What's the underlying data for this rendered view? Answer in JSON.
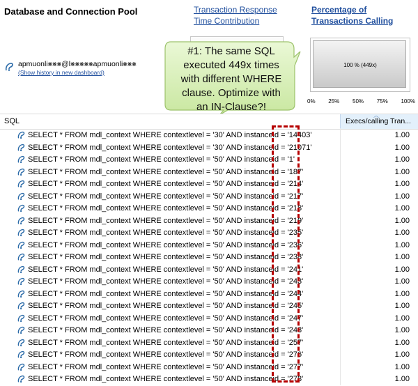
{
  "header": {
    "title": "Database and Connection Pool",
    "tab_response_line1": "Transaction Response",
    "tab_response_line2": "Time Contribution",
    "tab_pct_line1": "Percentage of",
    "tab_pct_line2": "Transactions Calling"
  },
  "connection": {
    "name": "apmuonli⨳⨳⨳@l⨳⨳⨳⨳⨳apmuonli⨳⨳⨳",
    "history_link": "(Show history in new dashboard)"
  },
  "percent_chart": {
    "label": "100 % (449x)",
    "value_percent": 100,
    "ticks": [
      "0%",
      "25%",
      "50%",
      "75%",
      "100%"
    ]
  },
  "callout": {
    "text_lines": [
      "#1: The same SQL",
      "executed 449x times",
      "with different WHERE",
      "clause. Optimize with",
      "an IN-Clause?!"
    ],
    "fill": "#d6f0b4",
    "stroke": "#9cc26b"
  },
  "table": {
    "col_sql": "SQL",
    "col_execs": "Execs/calling Tran...",
    "rows": [
      {
        "sql": "SELECT * FROM mdl_context WHERE contextlevel = '30' AND instanceid = '14403'",
        "value": "1.00"
      },
      {
        "sql": "SELECT * FROM mdl_context WHERE contextlevel = '30' AND instanceid = '21071'",
        "value": "1.00"
      },
      {
        "sql": "SELECT * FROM mdl_context WHERE contextlevel = '50' AND instanceid = '1'",
        "value": "1.00"
      },
      {
        "sql": "SELECT * FROM mdl_context WHERE contextlevel = '50' AND instanceid = '187'",
        "value": "1.00"
      },
      {
        "sql": "SELECT * FROM mdl_context WHERE contextlevel = '50' AND instanceid = '214'",
        "value": "1.00"
      },
      {
        "sql": "SELECT * FROM mdl_context WHERE contextlevel = '50' AND instanceid = '217'",
        "value": "1.00"
      },
      {
        "sql": "SELECT * FROM mdl_context WHERE contextlevel = '50' AND instanceid = '218'",
        "value": "1.00"
      },
      {
        "sql": "SELECT * FROM mdl_context WHERE contextlevel = '50' AND instanceid = '219'",
        "value": "1.00"
      },
      {
        "sql": "SELECT * FROM mdl_context WHERE contextlevel = '50' AND instanceid = '235'",
        "value": "1.00"
      },
      {
        "sql": "SELECT * FROM mdl_context WHERE contextlevel = '50' AND instanceid = '236'",
        "value": "1.00"
      },
      {
        "sql": "SELECT * FROM mdl_context WHERE contextlevel = '50' AND instanceid = '238'",
        "value": "1.00"
      },
      {
        "sql": "SELECT * FROM mdl_context WHERE contextlevel = '50' AND instanceid = '241'",
        "value": "1.00"
      },
      {
        "sql": "SELECT * FROM mdl_context WHERE contextlevel = '50' AND instanceid = '243'",
        "value": "1.00"
      },
      {
        "sql": "SELECT * FROM mdl_context WHERE contextlevel = '50' AND instanceid = '244'",
        "value": "1.00"
      },
      {
        "sql": "SELECT * FROM mdl_context WHERE contextlevel = '50' AND instanceid = '245'",
        "value": "1.00"
      },
      {
        "sql": "SELECT * FROM mdl_context WHERE contextlevel = '50' AND instanceid = '247'",
        "value": "1.00"
      },
      {
        "sql": "SELECT * FROM mdl_context WHERE contextlevel = '50' AND instanceid = '248'",
        "value": "1.00"
      },
      {
        "sql": "SELECT * FROM mdl_context WHERE contextlevel = '50' AND instanceid = '257'",
        "value": "1.00"
      },
      {
        "sql": "SELECT * FROM mdl_context WHERE contextlevel = '50' AND instanceid = '276'",
        "value": "1.00"
      },
      {
        "sql": "SELECT * FROM mdl_context WHERE contextlevel = '50' AND instanceid = '277'",
        "value": "1.00"
      },
      {
        "sql": "SELECT * FROM mdl_context WHERE contextlevel = '50' AND instanceid = '278'",
        "value": "1.00"
      }
    ]
  },
  "colors": {
    "link": "#1f4e9d",
    "highlight_dash": "#b50000",
    "header_active_bg": "#e3f0fb"
  }
}
